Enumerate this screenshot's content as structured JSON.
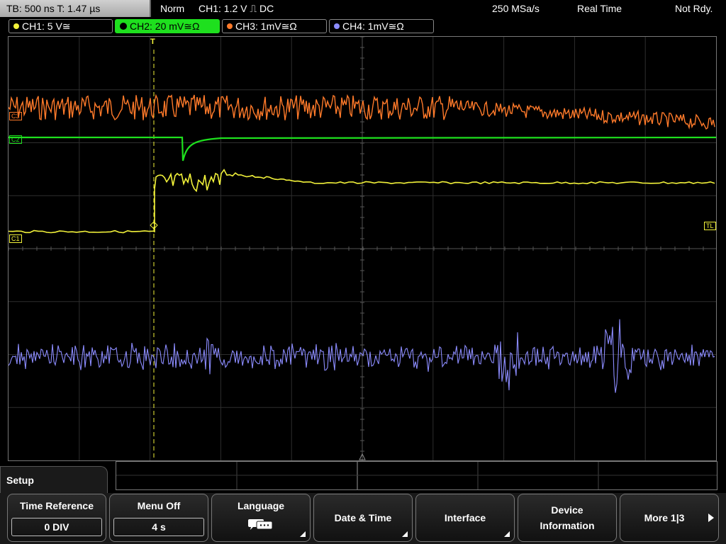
{
  "status": {
    "timebase": "TB: 500 ns   T: 1.47 µs",
    "mode": "Norm",
    "trigger": "CH1: 1.2 V ⎍ DC",
    "sample_rate": "250 MSa/s",
    "acq": "Real Time",
    "ready": "Not Rdy."
  },
  "channels": [
    {
      "label": "CH1: 5 V≅",
      "color": "#f2f23a"
    },
    {
      "label": "CH2: 20 mV≅Ω",
      "color": "#1ee01e"
    },
    {
      "label": "CH3: 1mV≅Ω",
      "color": "#ff7a2a"
    },
    {
      "label": "CH4: 1mV≅Ω",
      "color": "#8c8cff"
    }
  ],
  "markers": {
    "c1": "C1",
    "c2": "C2",
    "c3": "C3",
    "tl": "TL",
    "trig": "T"
  },
  "menu": {
    "title": "Setup",
    "time_reference": {
      "label": "Time Reference",
      "value": "0 DIV"
    },
    "menu_off": {
      "label": "Menu Off",
      "value": "4 s"
    },
    "language": {
      "label": "Language"
    },
    "date_time": {
      "label": "Date & Time"
    },
    "interface": {
      "label": "Interface"
    },
    "device_info": {
      "label_1": "Device",
      "label_2": "Information"
    },
    "more": {
      "label": "More 1|3"
    }
  }
}
